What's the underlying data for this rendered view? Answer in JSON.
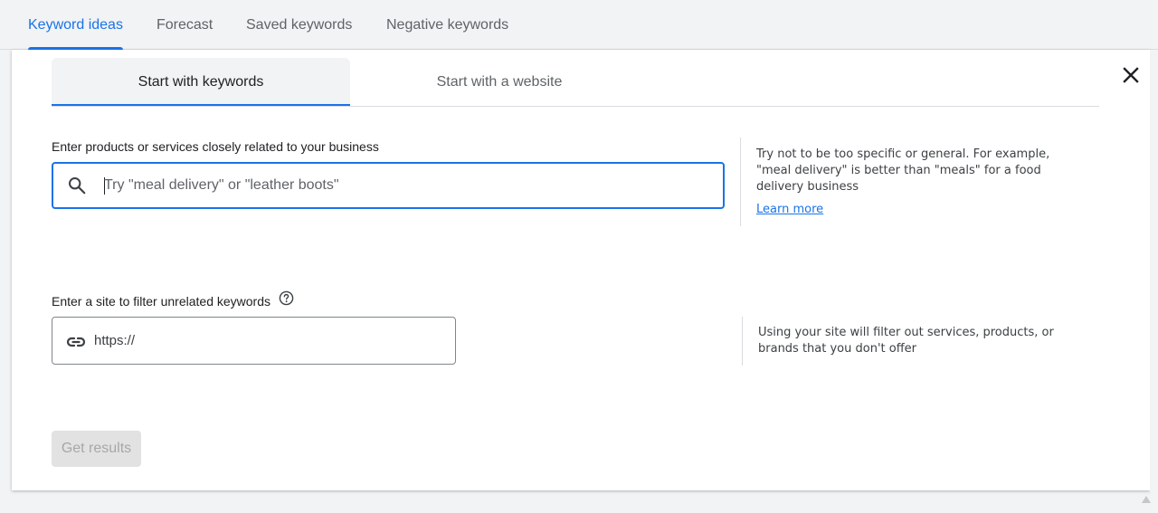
{
  "top_tabs": [
    {
      "label": "Keyword ideas",
      "active": true
    },
    {
      "label": "Forecast",
      "active": false
    },
    {
      "label": "Saved keywords",
      "active": false
    },
    {
      "label": "Negative keywords",
      "active": false
    }
  ],
  "sub_tabs": [
    {
      "label": "Start with keywords",
      "active": true
    },
    {
      "label": "Start with a website",
      "active": false
    }
  ],
  "keywords_section": {
    "label": "Enter products or services closely related to your business",
    "input_value": "",
    "placeholder": "Try \"meal delivery\" or \"leather boots\"",
    "tip": "Try not to be too specific or general. For example, \"meal delivery\" is better than \"meals\" for a food delivery business",
    "learn_more": "Learn more"
  },
  "site_section": {
    "label": "Enter a site to filter unrelated keywords",
    "input_value": "",
    "placeholder": "https://",
    "tip": "Using your site will filter out services, products, or brands that you don't offer"
  },
  "get_results_label": "Get results",
  "icons": {
    "search": "search-icon",
    "link": "link-icon",
    "help": "help-icon",
    "close": "close-icon"
  },
  "colors": {
    "accent": "#1a73e8",
    "disabled_bg": "#e2e2e2",
    "disabled_text": "#a7a7a7"
  }
}
